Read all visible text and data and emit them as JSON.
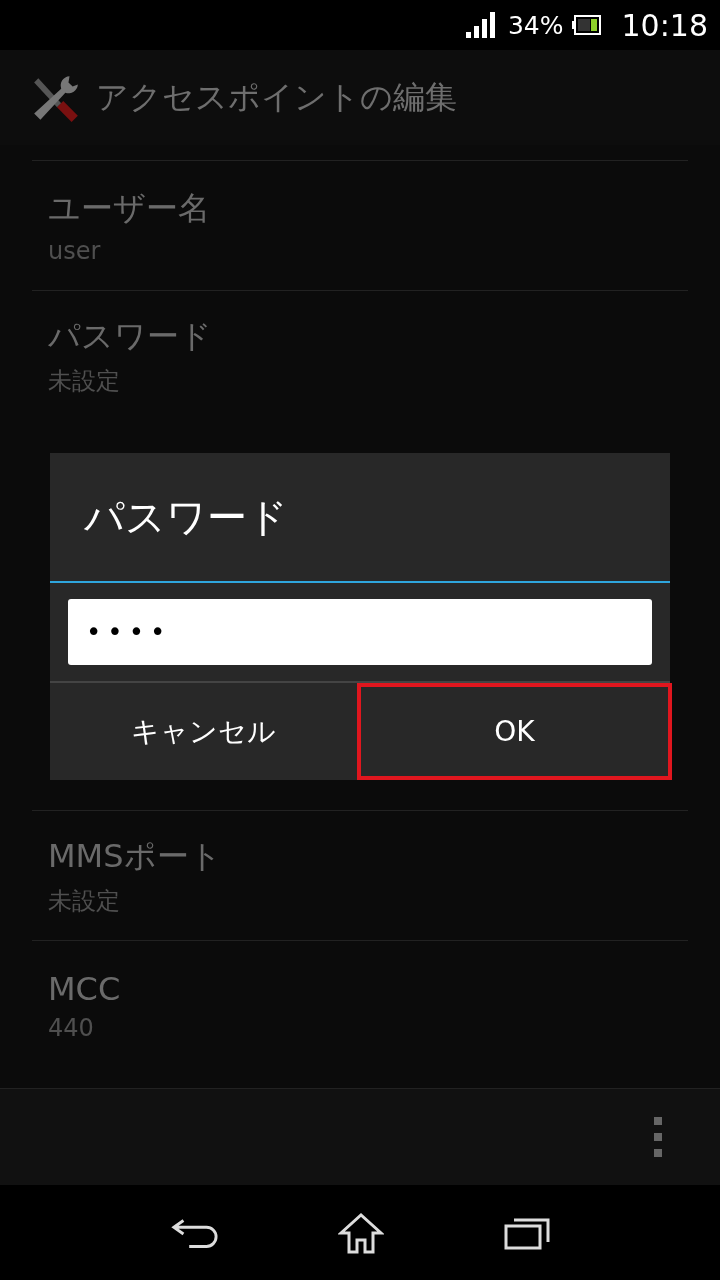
{
  "status_bar": {
    "battery": "34%",
    "time": "10:18"
  },
  "action_bar": {
    "title": "アクセスポイントの編集"
  },
  "settings": [
    {
      "title": "ユーザー名",
      "value": "user"
    },
    {
      "title": "パスワード",
      "value": "未設定"
    }
  ],
  "settings_below": [
    {
      "title": "MMSポート",
      "value": "未設定"
    },
    {
      "title": "MCC",
      "value": "440"
    }
  ],
  "dialog": {
    "title": "パスワード",
    "value": "••••",
    "buttons": [
      {
        "label": "キャンセル",
        "highlighted": false
      },
      {
        "label": "OK",
        "highlighted": true
      }
    ]
  }
}
